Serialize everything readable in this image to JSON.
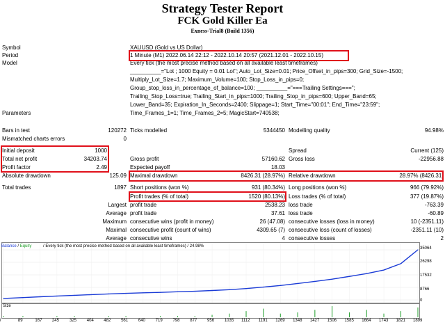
{
  "header": {
    "title": "Strategy Tester Report",
    "subtitle": "FCK Gold Killer Ea",
    "build": "Exness-Trial8 (Build 1356)"
  },
  "settings": {
    "symbol_label": "Symbol",
    "symbol_value": "XAUUSD (Gold vs US Dollar)",
    "period_label": "Period",
    "period_value": "1 Minute (M1) 2022.06.14 22:12 - 2022.10.14 20:57 (2021.12.01 - 2022.10.15)",
    "model_label": "Model",
    "model_lines": [
      "Every tick (the most precise method based on all available least timeframes)",
      "__________=\"Lot ; 1000 Equity = 0.01 Lot\"; Auto_Lot_Size=0.01; Price_Offset_in_pips=300; Grid_Size=-1500;",
      "Multiply_Lot_Size=1.7; Maximum_Volume=100; Stop_Loss_in_pips=0;",
      "Group_stop_loss_in_percentage_of_balance=100; __________=\"===Trailing Settings===\";",
      "Trailing_Stop_Loss=true; Trailing_Start_in_pips=1000; Trailing_Stop_in_pips=600; Upper_Band=65;",
      "Lower_Band=35; Expiration_In_Seconds=2400; Slippage=1; Start_Time=\"00:01\"; End_Time=\"23:59\";",
      "Time_Frames_1=1; Time_Frames_2=5; MagicStart=740538;"
    ],
    "parameters_label": "Parameters"
  },
  "stats": {
    "bars_label": "Bars in test",
    "bars_value": "120272",
    "ticks_label": "Ticks modelled",
    "ticks_value": "5344450",
    "quality_label": "Modelling quality",
    "quality_value": "94.98%",
    "mismatch_label": "Mismatched charts errors",
    "mismatch_value": "0",
    "deposit_label": "Initial deposit",
    "deposit_value": "1000",
    "spread_label": "Spread",
    "spread_value": "Current (125)",
    "netprofit_label": "Total net profit",
    "netprofit_value": "34203.74",
    "grossprofit_label": "Gross profit",
    "grossprofit_value": "57160.62",
    "grossloss_label": "Gross loss",
    "grossloss_value": "-22956.88",
    "pf_label": "Profit factor",
    "pf_value": "2.49",
    "payoff_label": "Expected payoff",
    "payoff_value": "18.03",
    "absdd_label": "Absolute drawdown",
    "absdd_value": "125.09",
    "maxdd_label": "Maximal drawdown",
    "maxdd_value": "8426.31 (28.97%)",
    "reldd_label": "Relative drawdown",
    "reldd_value": "28.97% (8426.31)",
    "trades_label": "Total trades",
    "trades_value": "1897",
    "short_label": "Short positions (won %)",
    "short_value": "931 (80.34%)",
    "long_label": "Long positions (won %)",
    "long_value": "966 (79.92%)",
    "ptrades_label": "Profit trades (% of total)",
    "ptrades_value": "1520 (80.13%)",
    "ltrades_label": "Loss trades (% of total)",
    "ltrades_value": "377 (19.87%)",
    "largest_label": "Largest",
    "largest_p_label": "profit trade",
    "largest_p_value": "2538.23",
    "largest_l_label": "loss trade",
    "largest_l_value": "-763.39",
    "average_label": "Average",
    "average_p_label": "profit trade",
    "average_p_value": "37.61",
    "average_l_label": "loss trade",
    "average_l_value": "-60.89",
    "maximum_label": "Maximum",
    "max_cw_label": "consecutive wins (profit in money)",
    "max_cw_value": "26 (47.08)",
    "max_cl_label": "consecutive losses (loss in money)",
    "max_cl_value": "10 (-2351.11)",
    "maximal_label": "Maximal",
    "mx_cp_label": "consecutive profit (count of wins)",
    "mx_cp_value": "4309.65 (7)",
    "mx_cl_label": "consecutive loss (count of losses)",
    "mx_cl_value": "-2351.11 (10)",
    "avg2_label": "Average",
    "avg_cw_label": "consecutive wins",
    "avg_cw_value": "4",
    "avg_cl_label": "consecutive losses",
    "avg_cl_value": "2"
  },
  "chart_data": {
    "type": "line",
    "title": "Balance / Equity / Every tick (the most precise method based on all available least timeframes) / 24.98%",
    "legend": [
      {
        "name": "Balance",
        "color": "#1a3bd6"
      },
      {
        "name": "Equity",
        "color": "#1f9e2a"
      }
    ],
    "y_ticks": [
      "35064",
      "26298",
      "17532",
      "8766",
      "0"
    ],
    "ylim": [
      0,
      35204
    ],
    "x_ticks": [
      "0",
      "89",
      "167",
      "245",
      "325",
      "404",
      "482",
      "561",
      "640",
      "719",
      "798",
      "877",
      "956",
      "1035",
      "1112",
      "1191",
      "1269",
      "1348",
      "1427",
      "1506",
      "1585",
      "1664",
      "1743",
      "1821",
      "1899"
    ],
    "x": [
      0,
      89,
      167,
      245,
      325,
      404,
      482,
      561,
      640,
      719,
      798,
      877,
      956,
      1035,
      1112,
      1191,
      1269,
      1348,
      1427,
      1506,
      1585,
      1664,
      1743,
      1821,
      1899
    ],
    "balance": [
      1000,
      1600,
      2200,
      2700,
      3200,
      3700,
      4200,
      4600,
      5000,
      5300,
      5700,
      6100,
      6600,
      7200,
      8000,
      9000,
      10100,
      11500,
      13000,
      14600,
      16500,
      18500,
      21000,
      25500,
      35204
    ],
    "size_label": "Size",
    "size_values": [
      1,
      1,
      0,
      1,
      1,
      0,
      1,
      1,
      0,
      1,
      1,
      1,
      2,
      3,
      5,
      7,
      3,
      4,
      6,
      9,
      4,
      6,
      3,
      5,
      8
    ]
  },
  "colors": {
    "highlight": "#e0101a",
    "balance": "#1a3bd6",
    "equity": "#1f9e2a"
  }
}
